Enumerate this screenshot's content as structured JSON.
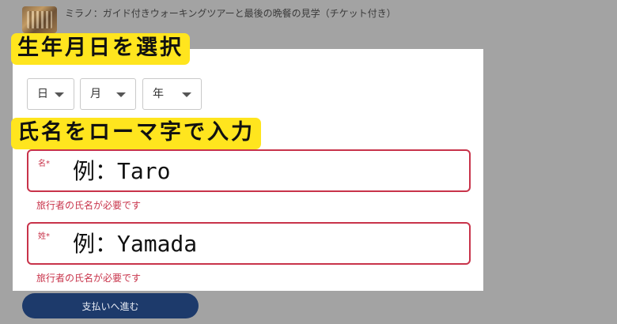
{
  "tour": {
    "title": "ミラノ：ガイド付きウォーキングツアーと最後の晩餐の見学（チケット付き）"
  },
  "callouts": {
    "dob": "生年月日を選択",
    "name": "氏名をローマ字で入力"
  },
  "dob": {
    "day": "日",
    "month": "月",
    "year": "年"
  },
  "first_name": {
    "label": "名",
    "required_mark": "*",
    "placeholder": "例：Taro",
    "value": "",
    "error": "旅行者の氏名が必要です"
  },
  "last_name": {
    "label": "姓",
    "required_mark": "*",
    "placeholder": "例：Yamada",
    "value": "",
    "error": "旅行者の氏名が必要です"
  },
  "pay_button": {
    "label": "支払いへ進む"
  },
  "colors": {
    "callout_bg": "#ffe51e",
    "error": "#c8334a",
    "button_bg": "#1d3a6b",
    "overlay_bg": "#a3a3a3"
  }
}
